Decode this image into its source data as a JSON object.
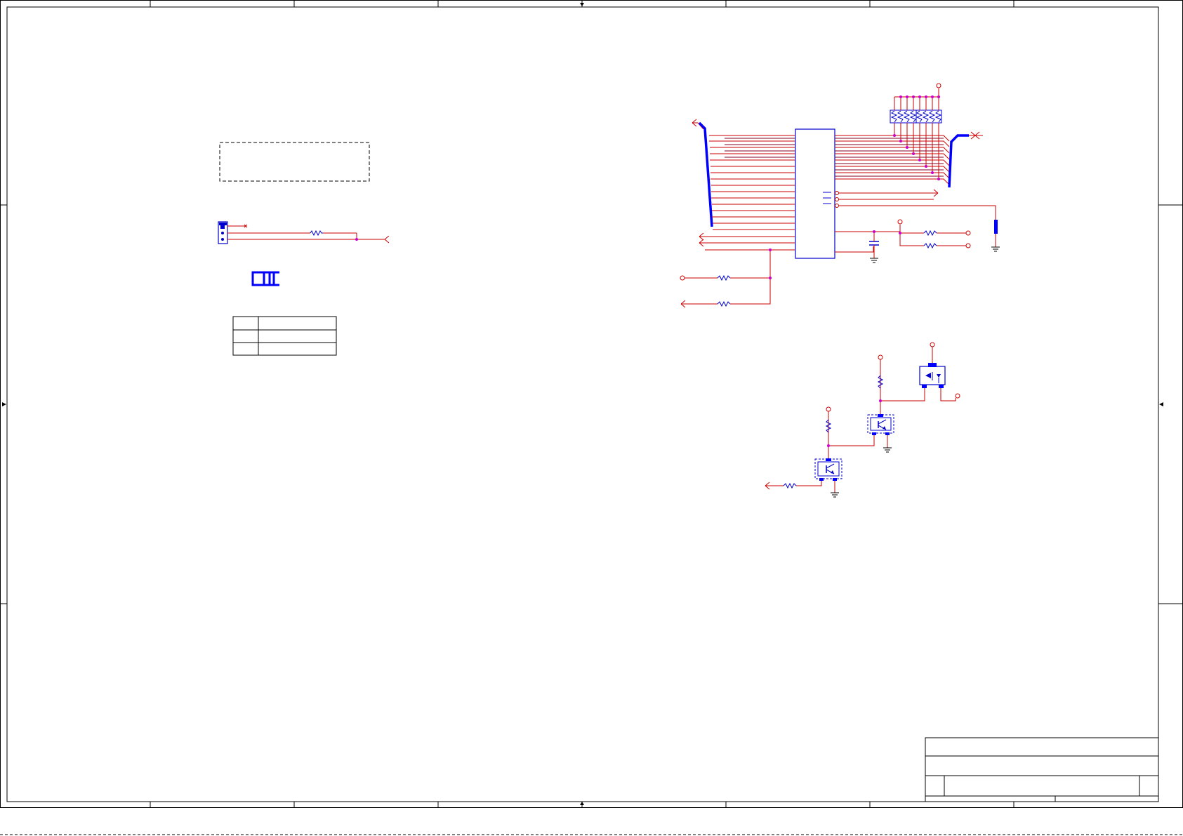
{
  "sheet": {
    "title_block": {
      "title": "",
      "size": "",
      "document_number": "",
      "rev": "",
      "date": "",
      "sheet_of": ""
    },
    "notes": {
      "dashed_note_box": "",
      "table_rows": [
        {
          "key": "",
          "value": ""
        },
        {
          "key": "",
          "value": ""
        },
        {
          "key": "",
          "value": ""
        }
      ]
    }
  },
  "colors": {
    "paper": "#ffffff",
    "border": "#000000",
    "wire": "#cc0000",
    "wire_dark": "#800020",
    "component": "#0000cc",
    "junction": "#cc00cc",
    "bus": "#0000ff"
  },
  "icons": [
    "resistor-icon",
    "capacitor-icon",
    "ground-icon",
    "power-port-icon",
    "off-page-connector-icon",
    "npn-transistor-icon",
    "mosfet-icon",
    "resistor-network-icon",
    "connector-header-icon",
    "switch-icon"
  ]
}
